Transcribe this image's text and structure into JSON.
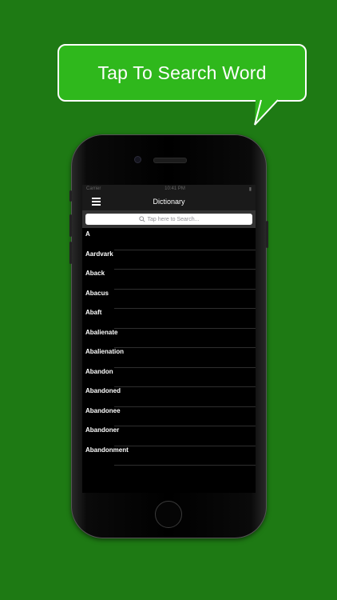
{
  "promo": {
    "bubble_text": "Tap To Search Word"
  },
  "app": {
    "title": "Dictionary",
    "status_bar": {
      "carrier": "Carrier",
      "time": "10:41 PM"
    },
    "search": {
      "placeholder": "Tap here to Search..."
    },
    "words": [
      "A",
      "Aardvark",
      "Aback",
      "Abacus",
      "Abaft",
      "Abalienate",
      "Abalienation",
      "Abandon",
      "Abandoned",
      "Abandonee",
      "Abandoner",
      "Abandonment"
    ]
  },
  "colors": {
    "background": "#1e7a14",
    "bubble": "#2fb81c",
    "screen": "#000000",
    "navbar": "#1a1a1a"
  },
  "icons": [
    "menu-icon",
    "search-icon",
    "camera-icon",
    "home-button-icon"
  ]
}
